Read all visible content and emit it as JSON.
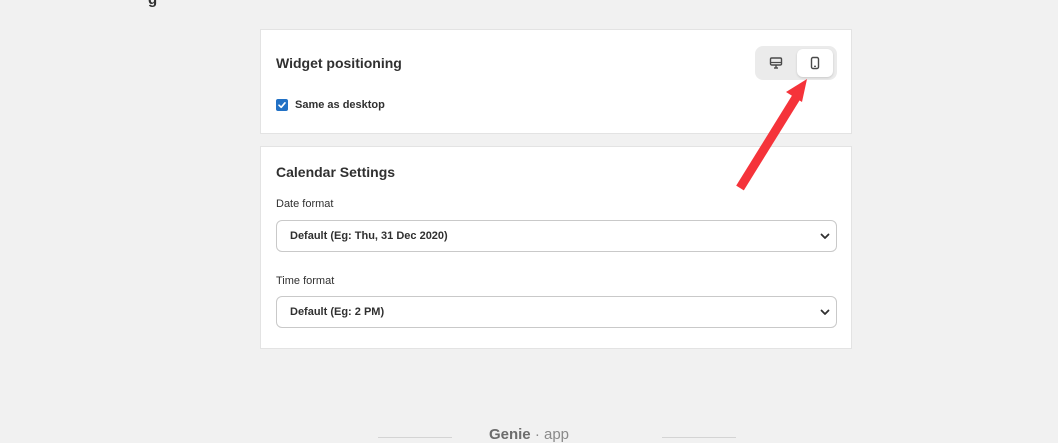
{
  "page": {
    "title_fragment": "g"
  },
  "widget_positioning": {
    "heading": "Widget positioning",
    "device_toggle": {
      "desktop_icon": "desktop-monitor-icon",
      "mobile_icon": "mobile-phone-icon",
      "selected": "mobile"
    },
    "same_as_desktop": {
      "label": "Same as desktop",
      "checked": true
    }
  },
  "calendar_settings": {
    "heading": "Calendar Settings",
    "date_format": {
      "label": "Date format",
      "value": "Default (Eg: Thu, 31 Dec 2020)"
    },
    "time_format": {
      "label": "Time format",
      "value": "Default (Eg: 2 PM)"
    }
  },
  "annotation": {
    "arrow_color": "#f5333a",
    "points_to": "mobile-toggle"
  },
  "footer": {
    "brand": "Genie",
    "suffix": " · app"
  },
  "colors": {
    "background": "#f1f1f1",
    "card": "#ffffff",
    "checkbox": "#2271c5",
    "text": "#303030"
  }
}
